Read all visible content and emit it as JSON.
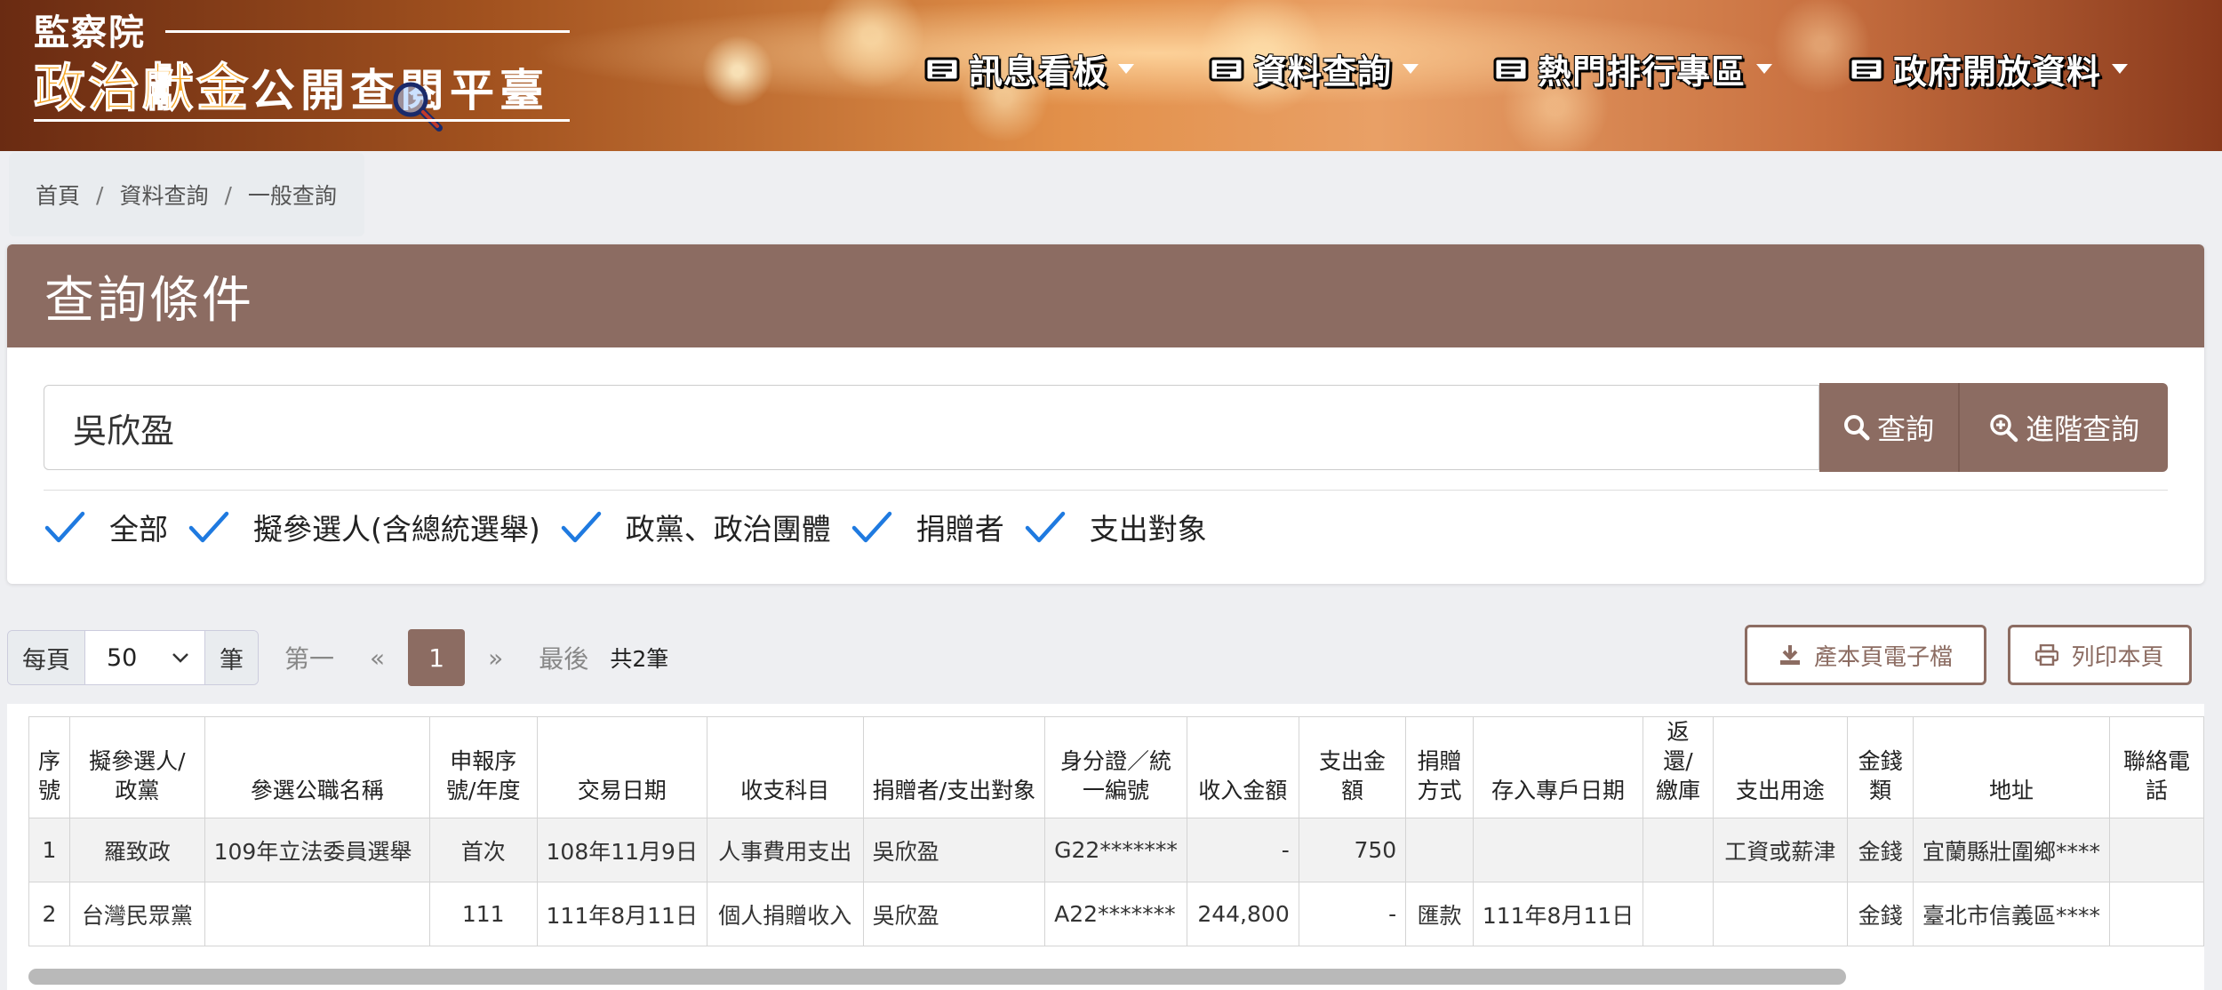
{
  "header": {
    "org": "監察院",
    "logo_highlight": "政治獻金",
    "logo_rest": "公開查閱平臺",
    "nav": [
      {
        "label": "訊息看板"
      },
      {
        "label": "資料查詢"
      },
      {
        "label": "熱門排行專區"
      },
      {
        "label": "政府開放資料"
      }
    ]
  },
  "breadcrumb": [
    "首頁",
    "資料查詢",
    "一般查詢"
  ],
  "search": {
    "card_title": "查詢條件",
    "query": "吳欣盈",
    "search_button": "查詢",
    "advanced_button": "進階查詢",
    "filters": [
      "全部",
      "擬參選人(含總統選舉)",
      "政黨、政治團體",
      "捐贈者",
      "支出對象"
    ]
  },
  "pagination": {
    "per_page_prefix": "每頁",
    "per_page_value": "50",
    "per_page_suffix": "筆",
    "first": "第一",
    "prev": "«",
    "current": "1",
    "next": "»",
    "last": "最後",
    "total": "共2筆"
  },
  "actions": {
    "export_label": "產本頁電子檔",
    "print_label": "列印本頁"
  },
  "table": {
    "headers": [
      "序號",
      "擬參選人/政黨",
      "參選公職名稱",
      "申報序號/年度",
      "交易日期",
      "收支科目",
      "捐贈者/支出對象",
      "身分證／統一編號",
      "收入金額",
      "支出金額",
      "捐贈方式",
      "存入專戶日期",
      "返還/繳庫",
      "支出用途",
      "金錢類",
      "地址",
      "聯絡電話"
    ],
    "rows": [
      [
        "1",
        "羅致政",
        "109年立法委員選舉",
        "首次",
        "108年11月9日",
        "人事費用支出",
        "吳欣盈",
        "G22*******",
        "-",
        "750",
        "",
        "",
        "",
        "工資或薪津",
        "金錢",
        "宜蘭縣壯圍鄉****",
        ""
      ],
      [
        "2",
        "台灣民眾黨",
        "",
        "111",
        "111年8月11日",
        "個人捐贈收入",
        "吳欣盈",
        "A22*******",
        "244,800",
        "-",
        "匯款",
        "111年8月11日",
        "",
        "",
        "金錢",
        "臺北市信義區****",
        ""
      ]
    ]
  },
  "colors": {
    "accent": "#8c6c62",
    "check": "#1f7ae0",
    "logo_gold": "#f7a623"
  },
  "icons": [
    "magnifier-icon",
    "newspaper-icon",
    "caret-down-icon",
    "search-icon",
    "zoom-in-icon",
    "check-icon",
    "download-icon",
    "print-icon",
    "chevron-down-icon"
  ]
}
